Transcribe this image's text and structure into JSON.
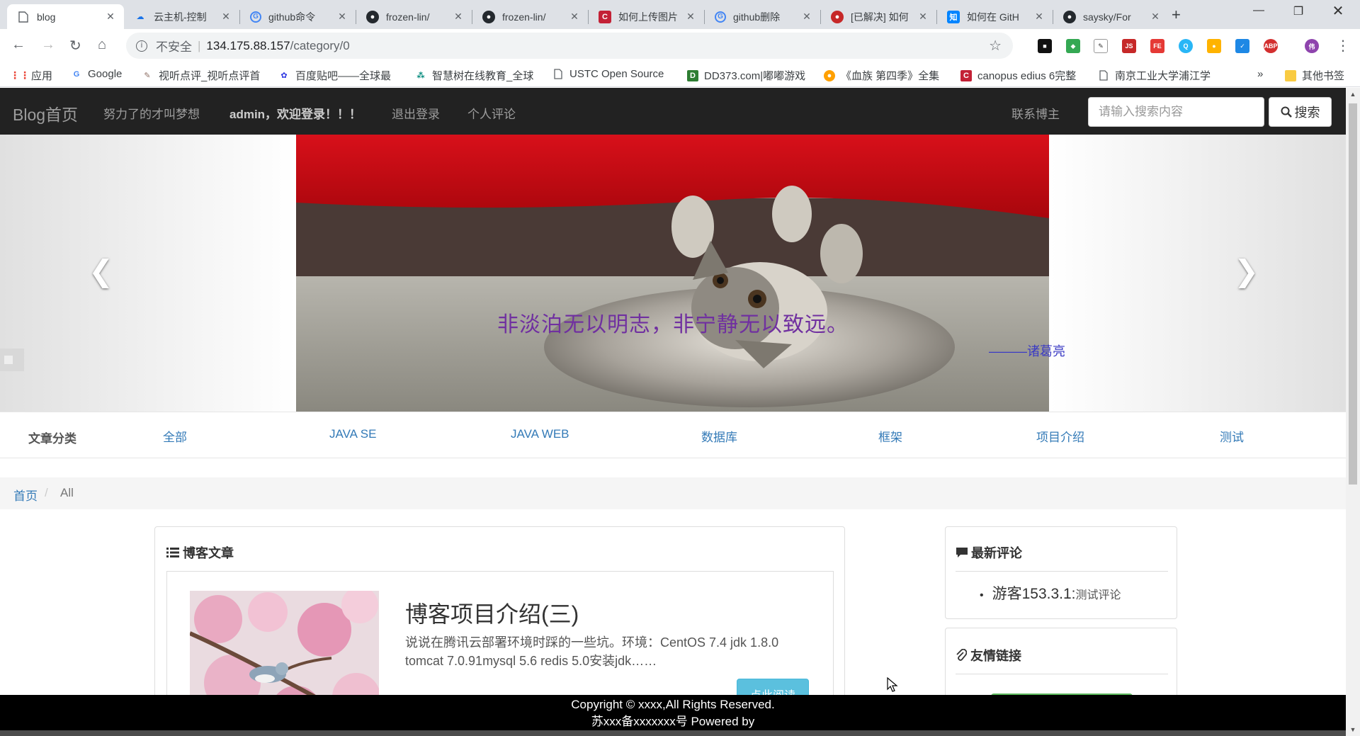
{
  "browser": {
    "tabs": [
      {
        "title": "blog",
        "icon": "page-icon",
        "active": true
      },
      {
        "title": "云主机-控制",
        "icon": "cloud-icon"
      },
      {
        "title": "github命令",
        "icon": "google-icon"
      },
      {
        "title": "frozen-lin/",
        "icon": "github-icon"
      },
      {
        "title": "frozen-lin/",
        "icon": "github-icon"
      },
      {
        "title": "如何上传图片",
        "icon": "csdn-icon"
      },
      {
        "title": "github删除",
        "icon": "google-icon"
      },
      {
        "title": "[已解决] 如何",
        "icon": "apple-icon"
      },
      {
        "title": "如何在 GitH",
        "icon": "zhihu-icon"
      },
      {
        "title": "saysky/For",
        "icon": "github-icon"
      }
    ],
    "address": {
      "insecure_label": "不安全",
      "host": "134.175.88.157",
      "path": "/category/0"
    },
    "bookmarks": [
      {
        "label": "应用",
        "icon": "apps-icon"
      },
      {
        "label": "Google",
        "icon": "google-icon"
      },
      {
        "label": "视听点评_视听点评首",
        "icon": "feather-icon"
      },
      {
        "label": "百度贴吧——全球最",
        "icon": "baidu-icon"
      },
      {
        "label": "智慧树在线教育_全球",
        "icon": "zhihuishu-icon"
      },
      {
        "label": "USTC Open Source",
        "icon": "page-icon"
      },
      {
        "label": "DD373.com|嘟嘟游戏",
        "icon": "dd373-icon"
      },
      {
        "label": "《血族 第四季》全集",
        "icon": "video-icon"
      },
      {
        "label": "canopus edius 6完整",
        "icon": "csdn-icon"
      },
      {
        "label": "南京工业大学浦江学",
        "icon": "page-icon"
      },
      {
        "label": "»",
        "icon": ""
      },
      {
        "label": "其他书签",
        "icon": "folder-icon"
      }
    ]
  },
  "navbar": {
    "brand": "Blog首页",
    "links": [
      "努力了的才叫梦想",
      "admin，欢迎登录！！！",
      "退出登录",
      "个人评论"
    ],
    "contact": "联系博主",
    "search_placeholder": "请输入搜索内容",
    "search_button": "搜索"
  },
  "carousel": {
    "quote": "非淡泊无以明志，非宁静无以致远。",
    "author": "———诸葛亮",
    "slide_count": 3,
    "active_index": 2
  },
  "categories": {
    "label": "文章分类",
    "items": [
      "全部",
      "JAVA SE",
      "JAVA WEB",
      "数据库",
      "框架",
      "项目介绍",
      "测试"
    ]
  },
  "breadcrumb": {
    "home": "首页",
    "separator": "/",
    "current": "All"
  },
  "articles_panel": {
    "heading": "博客文章",
    "articles": [
      {
        "title": "博客项目介绍(三)",
        "summary": "说说在腾讯云部署环境时踩的一些坑。环境：CentOS 7.4 jdk 1.8.0 tomcat 7.0.91mysql 5.6 redis 5.0安装jdk……",
        "button": "点此阅读"
      }
    ]
  },
  "comments_panel": {
    "heading": "最新评论",
    "items": [
      {
        "user": "游客153.3.1:",
        "text": "测试评论"
      }
    ]
  },
  "links_panel": {
    "heading": "友情链接"
  },
  "footer": {
    "line1": "Copyright © xxxx,All Rights Reserved.",
    "line2": "苏xxx备xxxxxxx号 Powered by"
  },
  "colors": {
    "navbar": "#222222",
    "link": "#337ab7",
    "quote": "#7030a0",
    "info_button": "#5bc0de",
    "footer": "#000000"
  }
}
